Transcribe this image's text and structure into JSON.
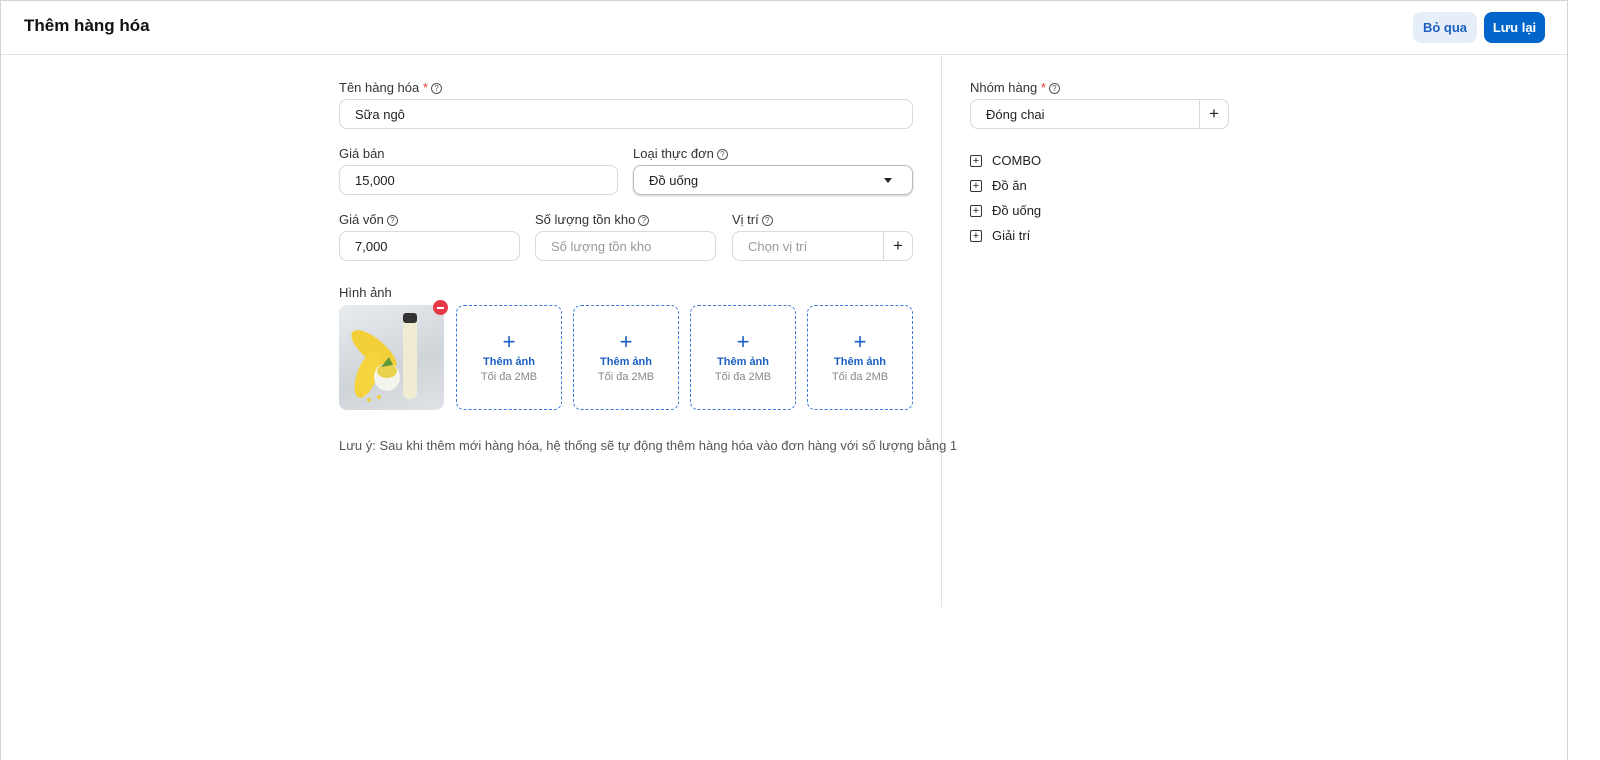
{
  "header": {
    "title": "Thêm hàng hóa",
    "skip_label": "Bỏ qua",
    "save_label": "Lưu lại"
  },
  "form": {
    "name": {
      "label": "Tên hàng hóa",
      "required": "*",
      "value": "Sữa ngô"
    },
    "price": {
      "label": "Giá bán",
      "value": "15,000"
    },
    "menu_type": {
      "label": "Loại thực đơn",
      "value": "Đồ uống"
    },
    "cost": {
      "label": "Giá vốn",
      "value": "7,000"
    },
    "stock": {
      "label": "Số lượng tồn kho",
      "placeholder": "Số lượng tồn kho"
    },
    "location": {
      "label": "Vị trí",
      "placeholder": "Chọn vị trí"
    },
    "images": {
      "label": "Hình ảnh",
      "slots": [
        {
          "title": "Thêm ảnh",
          "hint": "Tối đa 2MB"
        },
        {
          "title": "Thêm ảnh",
          "hint": "Tối đa 2MB"
        },
        {
          "title": "Thêm ảnh",
          "hint": "Tối đa 2MB"
        },
        {
          "title": "Thêm ảnh",
          "hint": "Tối đa 2MB"
        }
      ]
    },
    "note": "Lưu ý: Sau khi thêm mới hàng hóa, hệ thống sẽ tự động thêm hàng hóa vào đơn hàng với số lượng bằng 1"
  },
  "group": {
    "label": "Nhóm hàng",
    "required": "*",
    "value": "Đóng chai",
    "tree": [
      "COMBO",
      "Đồ ăn",
      "Đồ uống",
      "Giải trí"
    ]
  },
  "colors": {
    "primary": "#0066cc",
    "danger": "#e53945"
  }
}
